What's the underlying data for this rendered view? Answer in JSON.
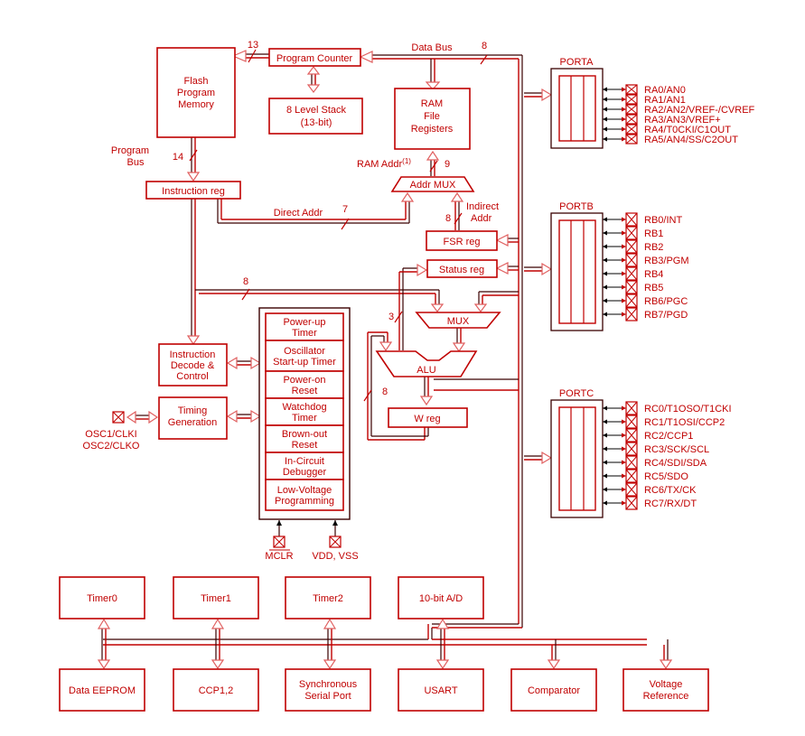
{
  "diagram": {
    "colors": {
      "primary": "#c00000",
      "dark": "#3a0000",
      "arrow_fill": "#ffffff"
    },
    "blocks": {
      "flash": [
        "Flash",
        "Program",
        "Memory"
      ],
      "pc": "Program Counter",
      "stack": [
        "8 Level Stack",
        "(13-bit)"
      ],
      "ram": [
        "RAM",
        "File",
        "Registers"
      ],
      "instr_reg": "Instruction reg",
      "addr_mux": "Addr MUX",
      "fsr": "FSR reg",
      "status": "Status reg",
      "mux": "MUX",
      "alu": "ALU",
      "wreg": "W reg",
      "decode": [
        "Instruction",
        "Decode &",
        "Control"
      ],
      "timing": [
        "Timing",
        "Generation"
      ]
    },
    "labels": {
      "data_bus": "Data Bus",
      "program_bus": [
        "Program",
        "Bus"
      ],
      "ram_addr": "RAM Addr",
      "ram_addr_note": "(1)",
      "direct_addr": "Direct Addr",
      "indirect_addr": [
        "Indirect",
        "Addr"
      ],
      "osc": [
        "OSC1/CLKI",
        "OSC2/CLKO"
      ],
      "mclr": "MCLR",
      "vdd": "VDD, VSS"
    },
    "bus_widths": {
      "pc_to_flash": "13",
      "data_bus": "8",
      "program_bus": "14",
      "ram_addr": "9",
      "direct_addr": "7",
      "indirect_addr": "8",
      "instr_to_mux": "8",
      "status_to_alu": "3",
      "w_loop": "8"
    },
    "supervisor": [
      [
        "Power-up",
        "Timer"
      ],
      [
        "Oscillator",
        "Start-up Timer"
      ],
      [
        "Power-on",
        "Reset"
      ],
      [
        "Watchdog",
        "Timer"
      ],
      [
        "Brown-out",
        "Reset"
      ],
      [
        "In-Circuit",
        "Debugger"
      ],
      [
        "Low-Voltage",
        "Programming"
      ]
    ],
    "ports": {
      "porta": {
        "name": "PORTA",
        "pins": [
          "RA0/AN0",
          "RA1/AN1",
          "RA2/AN2/VREF-/CVREF",
          "RA3/AN3/VREF+",
          "RA4/T0CKI/C1OUT",
          "RA5/AN4/SS/C2OUT"
        ]
      },
      "portb": {
        "name": "PORTB",
        "pins": [
          "RB0/INT",
          "RB1",
          "RB2",
          "RB3/PGM",
          "RB4",
          "RB5",
          "RB6/PGC",
          "RB7/PGD"
        ]
      },
      "portc": {
        "name": "PORTC",
        "pins": [
          "RC0/T1OSO/T1CKI",
          "RC1/T1OSI/CCP2",
          "RC2/CCP1",
          "RC3/SCK/SCL",
          "RC4/SDI/SDA",
          "RC5/SDO",
          "RC6/TX/CK",
          "RC7/RX/DT"
        ]
      }
    },
    "peripherals_top": [
      "Timer0",
      "Timer1",
      "Timer2",
      "10-bit A/D"
    ],
    "peripherals_bottom": [
      [
        "Data EEPROM"
      ],
      [
        "CCP1,2"
      ],
      [
        "Synchronous",
        "Serial Port"
      ],
      [
        "USART"
      ],
      [
        "Comparator"
      ],
      [
        "Voltage",
        "Reference"
      ]
    ]
  }
}
